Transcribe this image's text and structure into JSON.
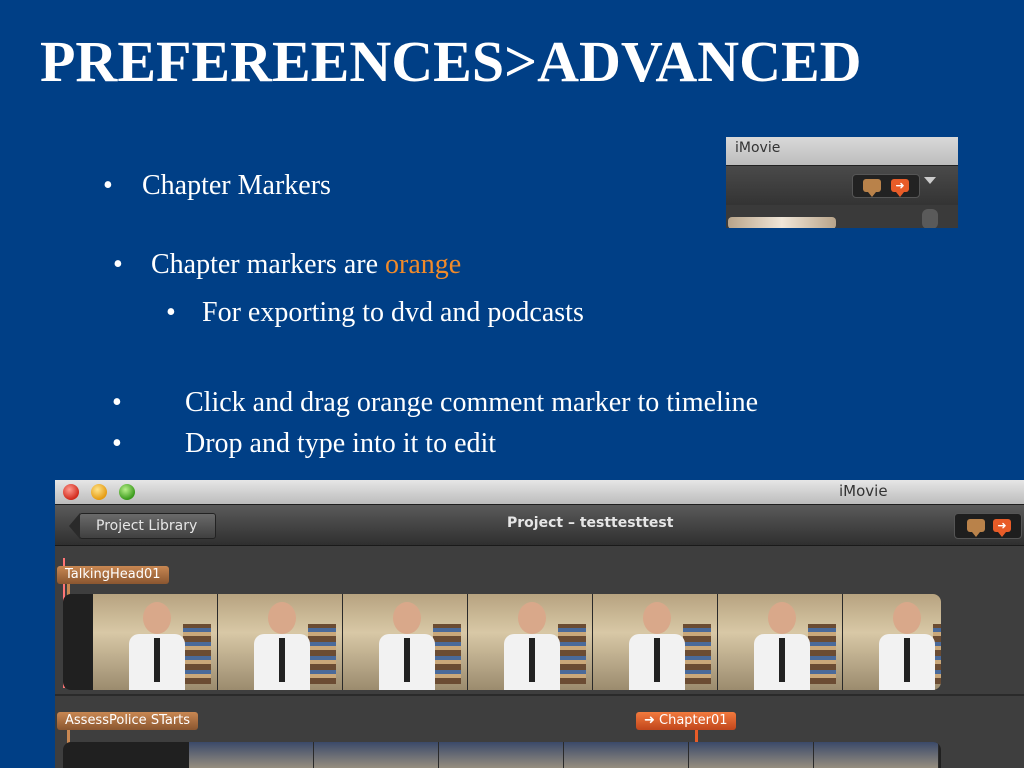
{
  "title": "PREFEREENCES>ADVANCED",
  "bullets": {
    "b1": "Chapter Markers",
    "b2_prefix": "Chapter markers are ",
    "b2_highlight": "orange",
    "b3": "For exporting to dvd and podcasts",
    "b4": "Click and drag orange comment marker to timeline",
    "b5": "Drop and type into it to edit",
    "dot": "•"
  },
  "mini_window": {
    "title": "iMovie"
  },
  "imovie": {
    "app_title": "iMovie",
    "project_library": "Project Library",
    "project_title": "Project – testtesttest",
    "clip1_label": "TalkingHead01",
    "clip2_label": "AssessPolice STarts",
    "chapter_label": "➜ Chapter01",
    "chapter_icon": "➜"
  },
  "colors": {
    "background": "#003f86",
    "orange": "#f08a2a",
    "comment_marker": "#b9824a",
    "chapter_marker": "#e85c28"
  }
}
